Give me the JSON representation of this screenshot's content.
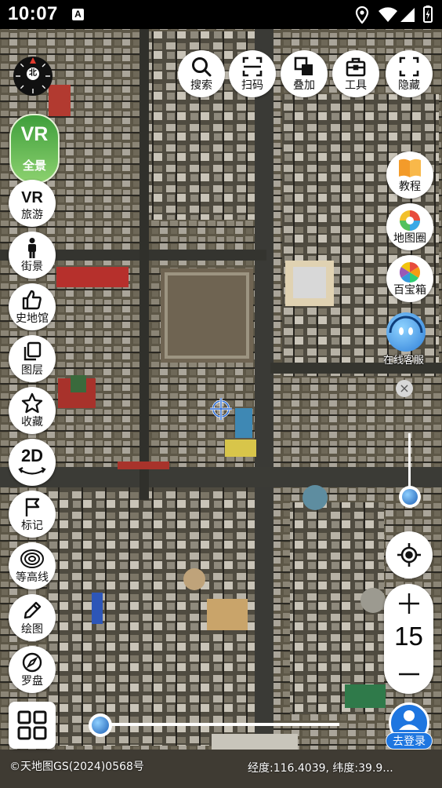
{
  "status_bar": {
    "time": "10:07",
    "app_badge": "A",
    "icons": [
      "location-icon",
      "wifi-icon",
      "signal-icon",
      "battery-icon"
    ]
  },
  "compass": {
    "label": "北"
  },
  "top_toolbar": [
    {
      "key": "search",
      "label": "搜索",
      "icon": "search-icon"
    },
    {
      "key": "scan",
      "label": "扫码",
      "icon": "scan-icon"
    },
    {
      "key": "overlay",
      "label": "叠加",
      "icon": "overlay-icon"
    },
    {
      "key": "tools",
      "label": "工具",
      "icon": "toolbox-icon"
    },
    {
      "key": "hide",
      "label": "隐藏",
      "icon": "hide-icon"
    }
  ],
  "vr_panorama": {
    "title": "VR",
    "label": "全景"
  },
  "left_toolbar": [
    {
      "key": "travel",
      "label": "旅游",
      "icon": "vr-icon"
    },
    {
      "key": "street_view",
      "label": "街景",
      "icon": "person-icon"
    },
    {
      "key": "history_museum",
      "label": "史地馆",
      "icon": "thumbs-up-icon"
    },
    {
      "key": "layers",
      "label": "图层",
      "icon": "layers-icon"
    },
    {
      "key": "favorites",
      "label": "收藏",
      "icon": "star-icon"
    },
    {
      "key": "mode_2d",
      "label": "2D",
      "icon": "rotate-icon"
    },
    {
      "key": "mark",
      "label": "标记",
      "icon": "flag-icon"
    },
    {
      "key": "contour",
      "label": "等高线",
      "icon": "contour-icon"
    },
    {
      "key": "draw",
      "label": "绘图",
      "icon": "pencil-icon"
    },
    {
      "key": "compass_tool",
      "label": "罗盘",
      "icon": "compass-icon"
    }
  ],
  "right_toolbar": [
    {
      "key": "tutorial",
      "label": "教程",
      "icon": "book-icon"
    },
    {
      "key": "map_circle",
      "label": "地图圈",
      "icon": "aperture-icon"
    },
    {
      "key": "toolbox",
      "label": "百宝箱",
      "icon": "pinwheel-icon"
    }
  ],
  "online_service": {
    "label": "在线客服",
    "close": "×"
  },
  "zoom": {
    "level": "15",
    "plus": "+",
    "minus": "−"
  },
  "login": {
    "label": "去登录"
  },
  "footer": {
    "copyright": "©天地图GS(2024)0568号",
    "coords": "经度:116.4039, 纬度:39.9..."
  },
  "colors": {
    "accent_blue": "#1e76e0",
    "vr_green": "#4aa840",
    "button_bg": "#ffffff"
  }
}
